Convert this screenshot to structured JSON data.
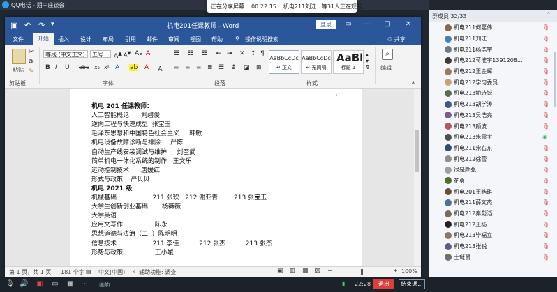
{
  "qq": {
    "title": "QQ电话 - 期中座谈会",
    "share_status": "正在分享屏幕",
    "share_time": "00:22:15",
    "watchers": "机电211刘江...等31人正在观看",
    "group_count": "群成员 32/33",
    "bottom_status": "画质",
    "time": "22:28",
    "exit_label": "退出",
    "end_share_label": "结束通..."
  },
  "word": {
    "title": "机电201任课教师 - Word",
    "login": "登录",
    "tabs": [
      "文件",
      "开始",
      "插入",
      "设计",
      "布局",
      "引用",
      "邮件",
      "审阅",
      "视图",
      "帮助"
    ],
    "tell_me": "操作说明搜索",
    "share": "共享",
    "ribbon": {
      "paste": "粘贴",
      "clipboard": "剪贴板",
      "font_name": "等线 (中文正文)",
      "font_size": "五号",
      "font_group": "字体",
      "para_group": "段落",
      "styles_group": "样式",
      "editing": "编辑",
      "styles": [
        {
          "preview": "AaBbCcDc",
          "name": "↵ 正文"
        },
        {
          "preview": "AaBbCcDc",
          "name": "↵ 无间隔"
        },
        {
          "preview": "AaBl",
          "name": "标题 1"
        }
      ]
    },
    "doc_lines": [
      {
        "text": "机电 201 任课教师：",
        "bold": true
      },
      {
        "text": "人工智能概论      刘碧俊"
      },
      {
        "text": "逆向工程与快速成型  张宝玉"
      },
      {
        "text": "毛泽东思想和中国特色社会主义     韩敏"
      },
      {
        "text": "机电设备故障诊断与排除     严陈"
      },
      {
        "text": "自动生产线安装调试与维护     刘奎武"
      },
      {
        "text": "简单机电一体化系统的制作   王文乐"
      },
      {
        "text": "运动控制技术      唐媛红"
      },
      {
        "text": "形式与政策    严贝贝"
      },
      {
        "text": "机电 2021 级",
        "bold": true
      },
      {
        "text": "机械基础                  211 张欢   212 谢亚青        213 张宝玉"
      },
      {
        "text": "大学生创新创业基础       杨薇薇"
      },
      {
        "text": "大学英语"
      },
      {
        "text": "应用文写作                陈永"
      },
      {
        "text": "思想道德与法治（二  ）陈明明"
      },
      {
        "text": "信息技术                  211 李佳          212 张杰          213 张杰"
      },
      {
        "text": "形势与政策                王小媛"
      }
    ],
    "status": {
      "page": "第 1 页，共 1 页",
      "words": "181 个字",
      "lang": "中文(中国)",
      "accessibility": "辅助功能: 调查",
      "zoom": "100%"
    }
  },
  "members": [
    {
      "name": "机电211何嘉伟",
      "color": "#8a6a4f"
    },
    {
      "name": "机电211刘江",
      "color": "#4d7fb5"
    },
    {
      "name": "机电211杨浩宇",
      "color": "#6c7a89"
    },
    {
      "name": "机电212蒋淮宇1391208...",
      "color": "#3b3b3b"
    },
    {
      "name": "机电212王金辉",
      "color": "#9b7a5c"
    },
    {
      "name": "机电212学习委员",
      "color": "#c9a27a"
    },
    {
      "name": "机电213鲍诗铖",
      "color": "#5a6e4f"
    },
    {
      "name": "机电213胡学涛",
      "color": "#3d5a80"
    },
    {
      "name": "机电213吴浩亮",
      "color": "#7a5c8f"
    },
    {
      "name": "机电213颜波",
      "color": "#b05a5a"
    },
    {
      "name": "机电213朱震宇",
      "color": "#4f4f4f"
    },
    {
      "name": "机电211宋右东",
      "color": "#2f4f6f"
    },
    {
      "name": "机电212徐蕾",
      "color": "#8f8f8f"
    },
    {
      "name": "很是颜张.",
      "color": "#a0a0a0"
    },
    {
      "name": "花勇",
      "color": "#556b2f"
    },
    {
      "name": "机电201王皓琪",
      "color": "#6b4f3b"
    },
    {
      "name": "机电211薛文杰",
      "color": "#4a6fa5"
    },
    {
      "name": "机电212秦彪滔",
      "color": "#7d6b5a"
    },
    {
      "name": "机电212王杨",
      "color": "#222222"
    },
    {
      "name": "机电213毕福立",
      "color": "#8a7a6a"
    },
    {
      "name": "机电213张锐",
      "color": "#5b5b8f"
    },
    {
      "name": "土斑鼠",
      "color": "#6f6f6f"
    }
  ]
}
